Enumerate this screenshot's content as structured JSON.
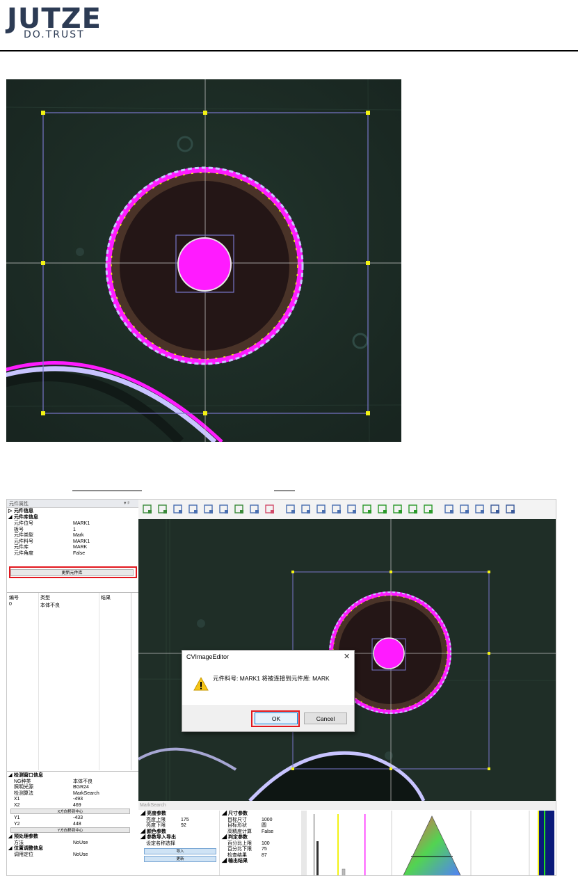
{
  "logo": {
    "main": "JUTZE",
    "sub": "DO.TRUST"
  },
  "colors": {
    "brand": "#2c3b54",
    "highlight": "#ff1bff",
    "marker": "#f2f214",
    "box": "#7876c9",
    "red_box": "#e2161d"
  },
  "left_panel": {
    "title": "元件属性",
    "title_controls": "▾ ᵖ",
    "sections_top": [
      {
        "label": "元件信息",
        "collapsed": true
      },
      {
        "label": "元件库信息",
        "collapsed": false
      }
    ],
    "props": [
      {
        "key": "元件位号",
        "value": "MARK1"
      },
      {
        "key": "板号",
        "value": "1"
      },
      {
        "key": "元件类型",
        "value": "Mark"
      },
      {
        "key": "元件料号",
        "value": "MARK1"
      },
      {
        "key": "元件库",
        "value": "MARK"
      },
      {
        "key": "元件角度",
        "value": "False"
      }
    ],
    "update_button": "更新元件库",
    "table": {
      "headers": [
        "编号",
        "类型",
        "结果"
      ],
      "rows": [
        {
          "id": "0",
          "type": "本体不良",
          "result": ""
        }
      ]
    },
    "lower_sections": [
      {
        "label": "检测窗口信息",
        "rows": [
          {
            "key": "NG种类",
            "value": "本体不良"
          },
          {
            "key": "照明光源",
            "value": "BGR24"
          },
          {
            "key": "检测算法",
            "value": "MarkSearch"
          },
          {
            "key": "X1",
            "value": "-493"
          },
          {
            "key": "X2",
            "value": "469"
          }
        ]
      },
      {
        "button": "X方向移到中心"
      },
      {
        "rows": [
          {
            "key": "Y1",
            "value": "-433"
          },
          {
            "key": "Y2",
            "value": "448"
          }
        ]
      },
      {
        "button": "Y方向移到中心"
      },
      {
        "label": "预处理参数",
        "rows": [
          {
            "key": "方法",
            "value": "NoUse"
          }
        ]
      },
      {
        "label": "位置调整信息",
        "rows": [
          {
            "key": "调用定位",
            "value": "NoUse"
          }
        ]
      }
    ]
  },
  "toolbar": {
    "icons": [
      "select-rect-icon",
      "select-rect-del-icon",
      "crop-icon",
      "fit-width-icon",
      "fit-height-icon",
      "fit-box-icon",
      "export-icon",
      "window-icon",
      "grid-icon",
      "save-icon",
      "open-folder-icon",
      "chart-icon",
      "chart-icon-2",
      "pie-icon",
      "zoom-in-icon",
      "zoom-out-icon",
      "chip-icon",
      "upload-icon",
      "download-icon",
      "pen-icon",
      "pen-add-icon",
      "pen-del-icon",
      "hammer-icon",
      "exit-icon"
    ]
  },
  "dialog": {
    "title": "CVImageEditor",
    "close": "✕",
    "message": "元件料号: MARK1 将被连接到元件库: MARK",
    "ok": "OK",
    "cancel": "Cancel"
  },
  "bottom_panel": {
    "title": "MarkSearch",
    "left_col": [
      {
        "section": "亮度参数"
      },
      {
        "key": "亮度上限",
        "value": "175"
      },
      {
        "key": "亮度下限",
        "value": "92"
      },
      {
        "section": "颜色参数"
      },
      {
        "section": "参数导入导出"
      },
      {
        "key": "设定名称选择",
        "value": ""
      }
    ],
    "buttons": [
      "导入",
      "更新"
    ],
    "right_col": [
      {
        "section": "尺寸参数"
      },
      {
        "key": "目标尺寸",
        "value": "1000"
      },
      {
        "key": "目标形状",
        "value": "圆"
      },
      {
        "key": "高精度计算",
        "value": "False"
      },
      {
        "section": "判定参数"
      },
      {
        "key": "百分比上限",
        "value": "100"
      },
      {
        "key": "百分比下限",
        "value": "75"
      },
      {
        "key": "检查结果",
        "value": "87"
      },
      {
        "section": "输出结果"
      }
    ]
  }
}
